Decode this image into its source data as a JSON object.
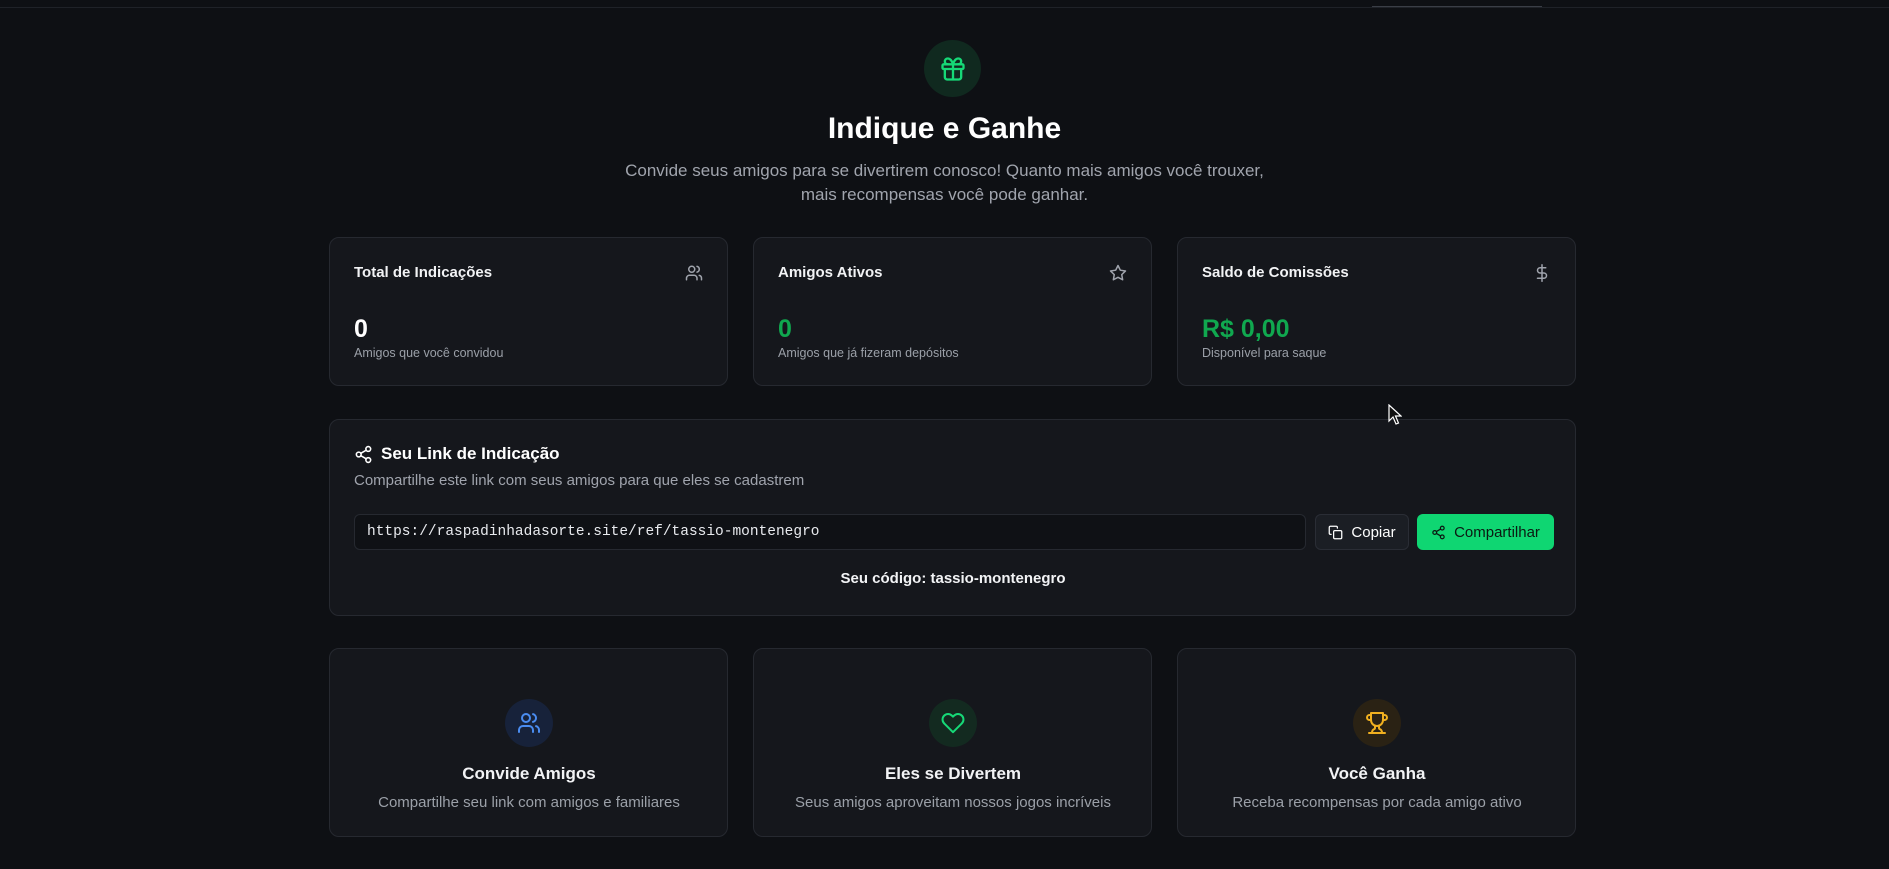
{
  "hero": {
    "icon": "gift-icon",
    "title": "Indique e Ganhe",
    "subtitle_line1": "Convide seus amigos para se divertirem conosco! Quanto mais amigos você trouxer,",
    "subtitle_line2": "mais recompensas você pode ganhar."
  },
  "stats": [
    {
      "title": "Total de Indicações",
      "icon": "users-icon",
      "value": "0",
      "desc": "Amigos que você convidou"
    },
    {
      "title": "Amigos Ativos",
      "icon": "star-icon",
      "value": "0",
      "desc": "Amigos que já fizeram depósitos"
    },
    {
      "title": "Saldo de Comissões",
      "icon": "dollar-icon",
      "value": "R$ 0,00",
      "desc": "Disponível para saque"
    }
  ],
  "referral": {
    "title": "Seu Link de Indicação",
    "subtitle": "Compartilhe este link com seus amigos para que eles se cadastrem",
    "link": "https://raspadinhadasorte.site/ref/tassio-montenegro",
    "copy_label": "Copiar",
    "share_label": "Compartilhar",
    "code_line": "Seu código: tassio-montenegro"
  },
  "steps": [
    {
      "icon": "users-icon",
      "title": "Convide Amigos",
      "desc": "Compartilhe seu link com amigos e familiares"
    },
    {
      "icon": "heart-icon",
      "title": "Eles se Divertem",
      "desc": "Seus amigos aproveitam nossos jogos incríveis"
    },
    {
      "icon": "trophy-icon",
      "title": "Você Ganha",
      "desc": "Receba recompensas por cada amigo ativo"
    }
  ],
  "colors": {
    "background": "#0e1014",
    "card": "#15171c",
    "accent_green": "#0fd672",
    "value_green": "#10a84f",
    "blue": "#4a8cf0",
    "gold": "#f0b020"
  }
}
